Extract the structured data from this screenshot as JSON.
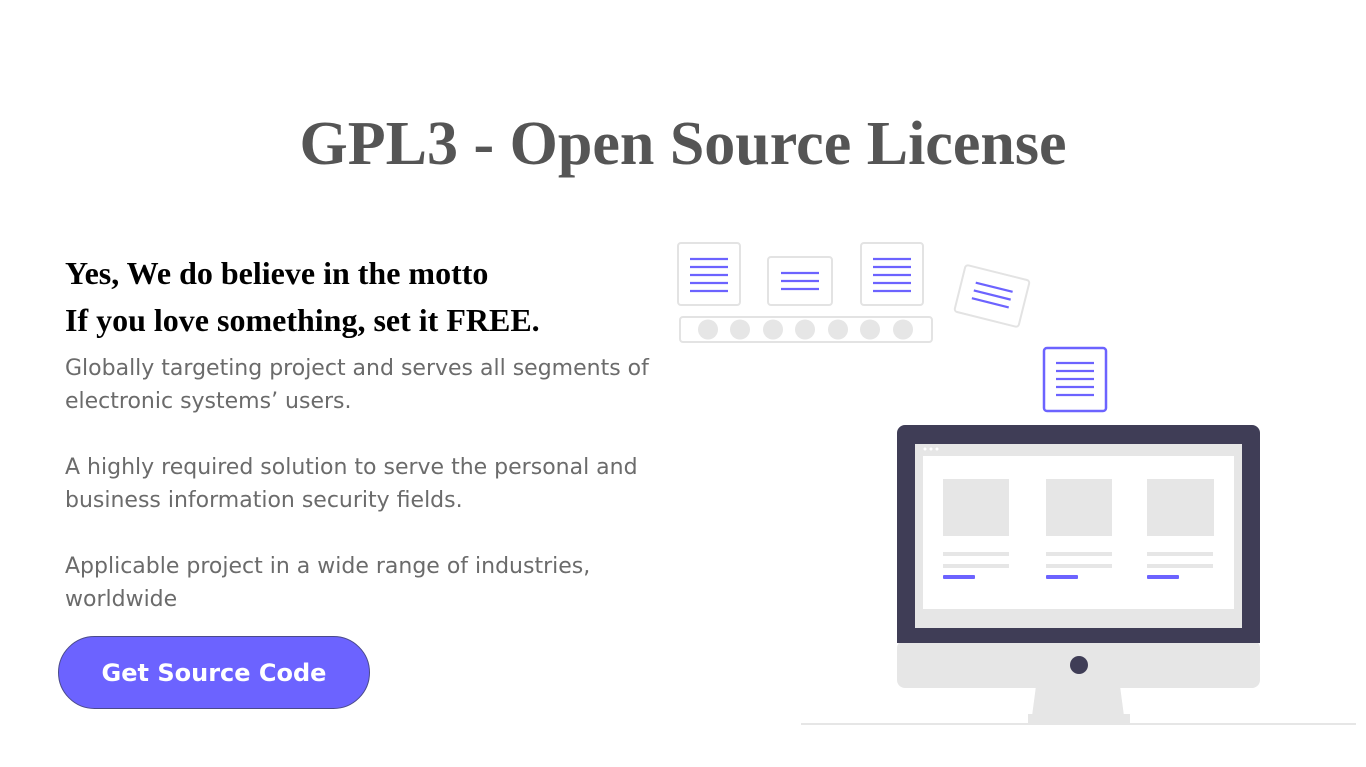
{
  "header": {
    "title": "GPL3 - Open Source License"
  },
  "motto": {
    "line1": "Yes, We do believe in the motto",
    "line2": "If you love something, set it FREE."
  },
  "paragraphs": [
    "Globally targeting project and serves all segments of electronic systems’ users.",
    "A highly required solution to serve the personal and business information security fields.",
    "Applicable project in a wide range of industries, worldwide"
  ],
  "cta": {
    "label": "Get Source Code"
  },
  "illustration": {
    "icons": [
      "document-icon",
      "conveyor-belt",
      "desktop-monitor-icon"
    ]
  },
  "colors": {
    "accent": "#6c63ff",
    "title": "#555555",
    "body_text": "#6b6b6b",
    "monitor_frame": "#3f3d56",
    "placeholder": "#e6e6e6"
  }
}
